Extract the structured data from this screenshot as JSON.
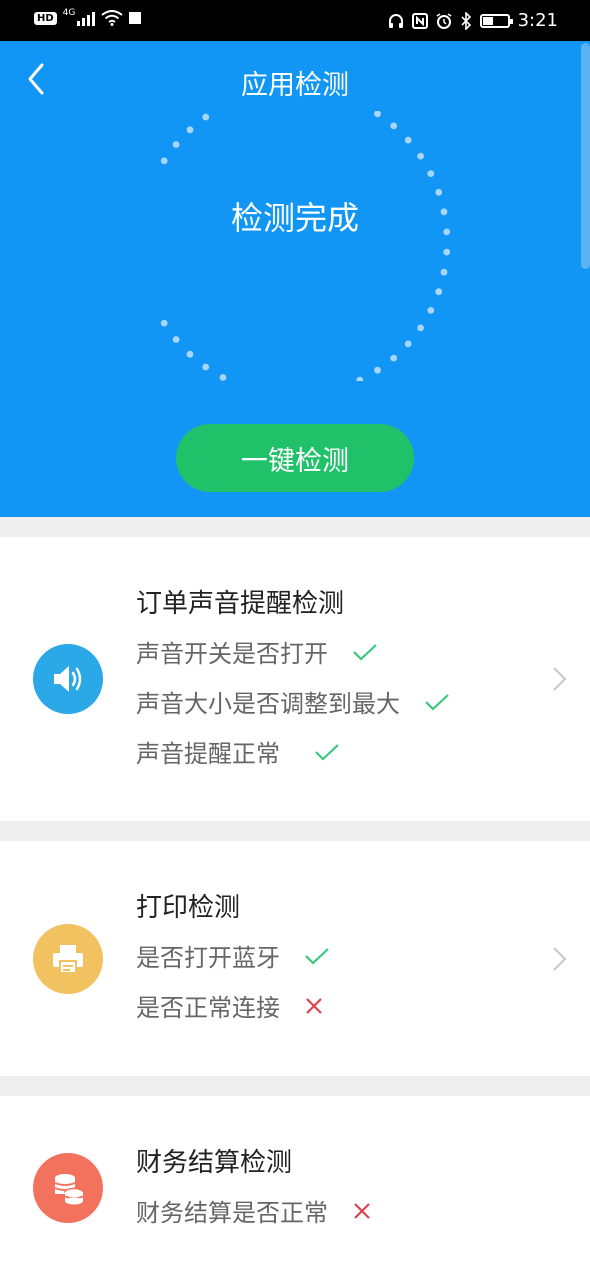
{
  "status_bar": {
    "time": "3:21",
    "network": "4G",
    "hd": "HD"
  },
  "header": {
    "title": "应用检测",
    "ring_status": "检测完成",
    "one_key_button": "一键检测"
  },
  "colors": {
    "header_bg": "#1296f5",
    "button_green": "#21c169",
    "check_green": "#3cc77e",
    "cross_red": "#e0424a"
  },
  "sections": [
    {
      "title": "订单声音提醒检测",
      "icon": "speaker-icon",
      "icon_color": "#2aa8e8",
      "items": [
        {
          "label": "声音开关是否打开",
          "status": "pass"
        },
        {
          "label": "声音大小是否调整到最大",
          "status": "pass"
        },
        {
          "label": "声音提醒正常",
          "status": "pass"
        }
      ]
    },
    {
      "title": "打印检测",
      "icon": "printer-icon",
      "icon_color": "#f2c261",
      "items": [
        {
          "label": "是否打开蓝牙",
          "status": "pass"
        },
        {
          "label": "是否正常连接",
          "status": "fail"
        }
      ]
    },
    {
      "title": "财务结算检测",
      "icon": "coins-icon",
      "icon_color": "#f3725e",
      "items": [
        {
          "label": "财务结算是否正常",
          "status": "fail"
        }
      ]
    }
  ]
}
